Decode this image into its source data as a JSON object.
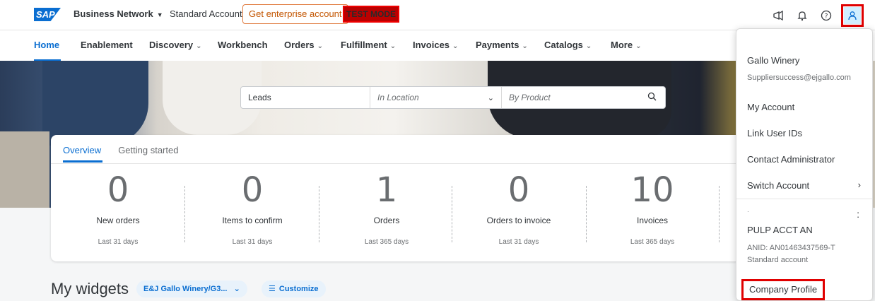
{
  "shell": {
    "logo": "SAP",
    "product": "Business Network",
    "account_type": "Standard Account",
    "enterprise_button": "Get enterprise account",
    "test_mode": "TEST MODE",
    "icons": [
      "megaphone-icon",
      "bell-icon",
      "help-icon",
      "user-icon"
    ]
  },
  "nav": {
    "items": [
      {
        "label": "Home",
        "dropdown": false,
        "active": true
      },
      {
        "label": "Enablement",
        "dropdown": false
      },
      {
        "label": "Discovery",
        "dropdown": true
      },
      {
        "label": "Workbench",
        "dropdown": false
      },
      {
        "label": "Orders",
        "dropdown": true
      },
      {
        "label": "Fulfillment",
        "dropdown": true
      },
      {
        "label": "Invoices",
        "dropdown": true
      },
      {
        "label": "Payments",
        "dropdown": true
      },
      {
        "label": "Catalogs",
        "dropdown": true
      },
      {
        "label": "More",
        "dropdown": true
      }
    ]
  },
  "search": {
    "leads": "Leads",
    "location_placeholder": "In Location",
    "product_placeholder": "By Product"
  },
  "overview": {
    "tabs": [
      "Overview",
      "Getting started"
    ],
    "kpis": [
      {
        "value": "0",
        "label": "New orders",
        "period": "Last 31 days"
      },
      {
        "value": "0",
        "label": "Items to confirm",
        "period": "Last 31 days"
      },
      {
        "value": "1",
        "label": "Orders",
        "period": "Last 365 days"
      },
      {
        "value": "0",
        "label": "Orders to invoice",
        "period": "Last 31 days"
      },
      {
        "value": "10",
        "label": "Invoices",
        "period": "Last 365 days"
      }
    ]
  },
  "widgets": {
    "title": "My widgets",
    "selector": "E&J Gallo Winery/G3...",
    "customize": "Customize"
  },
  "user_menu": {
    "name": "Gallo Winery",
    "email": "Suppliersuccess@ejgallo.com",
    "items": [
      "My Account",
      "Link User IDs",
      "Contact Administrator",
      "Switch Account"
    ],
    "account_name": "PULP ACCT AN",
    "anid": "ANID: AN01463437569-T",
    "account_status": "Standard account",
    "company_profile": "Company Profile"
  }
}
